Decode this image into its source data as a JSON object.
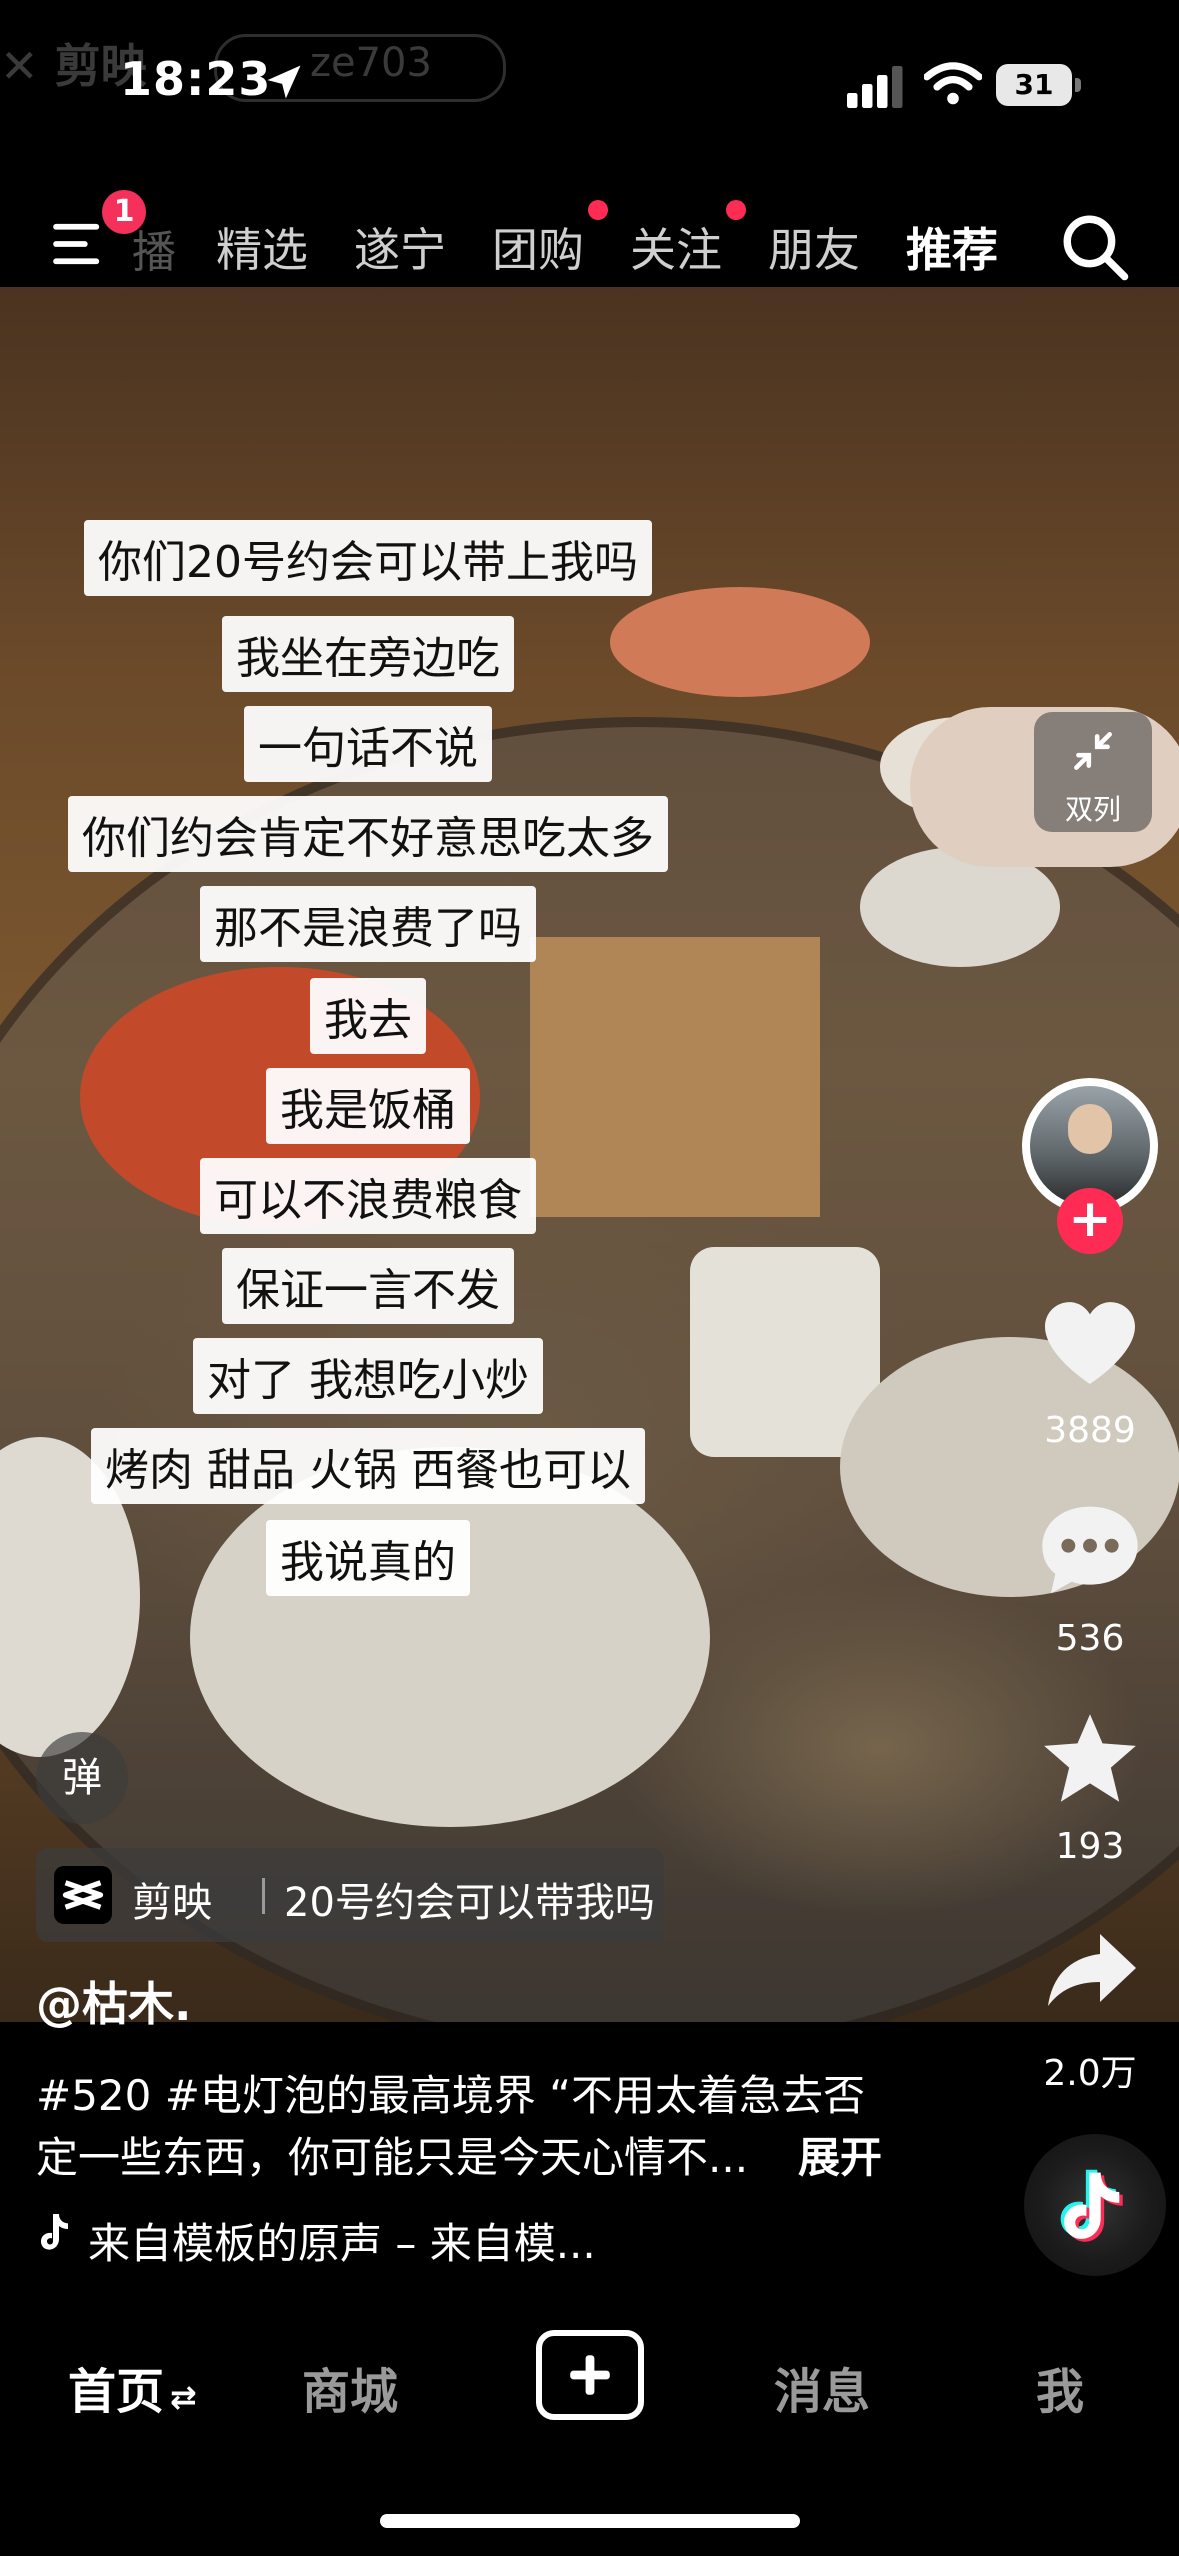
{
  "status_bar": {
    "time": "18:23",
    "ghost_app": "剪映",
    "ghost_search": "ze703",
    "battery": "31"
  },
  "top_nav": {
    "menu_badge": "1",
    "cut_tab": "播",
    "tabs": [
      {
        "label": "精选",
        "dot": false,
        "active": false
      },
      {
        "label": "遂宁",
        "dot": false,
        "active": false
      },
      {
        "label": "团购",
        "dot": true,
        "active": false
      },
      {
        "label": "关注",
        "dot": true,
        "active": false
      },
      {
        "label": "朋友",
        "dot": false,
        "active": false
      },
      {
        "label": "推荐",
        "dot": false,
        "active": true
      }
    ],
    "accent_color": "#fe2c55"
  },
  "captions": [
    "你们20号约会可以带上我吗",
    "我坐在旁边吃",
    "一句话不说",
    "你们约会肯定不好意思吃太多",
    "那不是浪费了吗",
    "我去",
    "我是饭桶",
    "可以不浪费粮食",
    "保证一言不发",
    "对了 我想吃小炒",
    "烤肉 甜品 火锅 西餐也可以",
    "我说真的"
  ],
  "side_actions": {
    "collapse_label": "双列",
    "like_count": "3889",
    "comment_count": "536",
    "favorite_count": "193",
    "share_count": "2.0万",
    "follow": "+"
  },
  "info": {
    "danmu": "弹",
    "capcut_name": "剪映",
    "capcut_title": "20号约会可以带我吗",
    "author": "@枯木.",
    "desc_line1": "#520 #电灯泡的最高境界 “不用太着急去否",
    "desc_line2": "定一些东西，你可能只是今天心情不...",
    "expand": "展开",
    "music": "来自模板的原声 – 来自模..."
  },
  "bottom_tabs": {
    "home": "首页",
    "mall": "商城",
    "messages": "消息",
    "me": "我"
  }
}
